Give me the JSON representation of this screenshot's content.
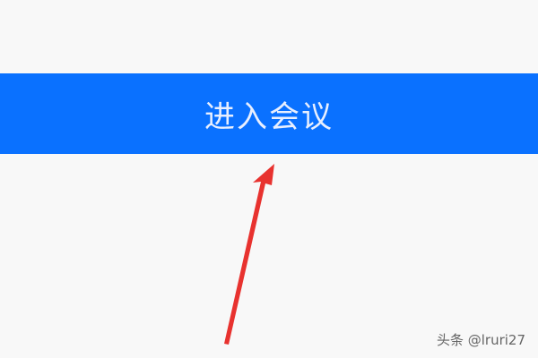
{
  "main": {
    "join_button_label": "进入会议"
  },
  "annotation": {
    "arrow_icon": "red-arrow-icon",
    "arrow_color": "#e8322f"
  },
  "watermark": {
    "text": "头条 @lruri27"
  },
  "colors": {
    "primary": "#0a71ff",
    "background": "#f8f8f8"
  }
}
